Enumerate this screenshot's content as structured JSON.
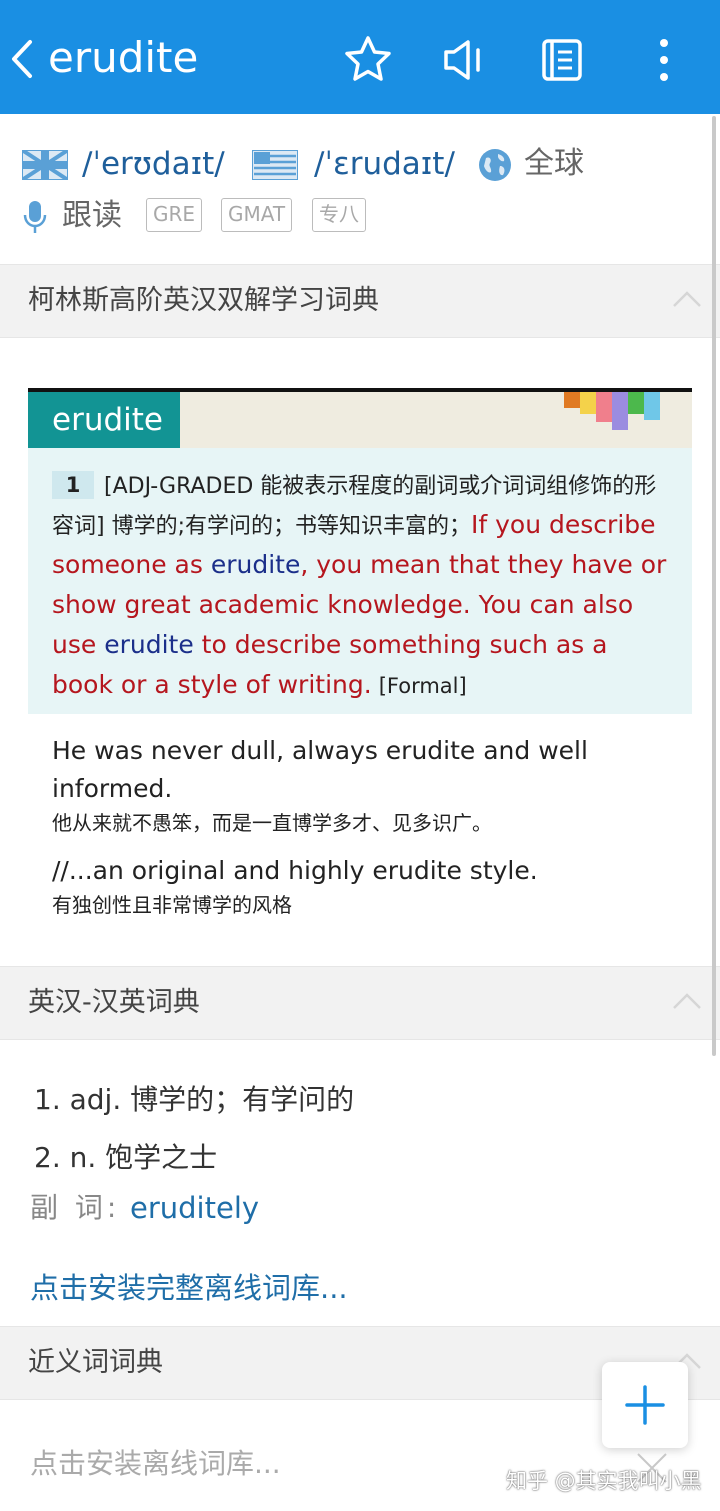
{
  "header": {
    "title": "erudite",
    "icons": [
      "back-icon",
      "star-icon",
      "speaker-icon",
      "notebook-icon",
      "more-icon"
    ]
  },
  "pronunciation": {
    "uk": "/ˈerʊdaɪt/",
    "us": "/ˈɛrudaɪt/",
    "global_label": "全球",
    "follow_read": "跟读",
    "tags": [
      "GRE",
      "GMAT",
      "专八"
    ]
  },
  "collins": {
    "section_title": "柯林斯高阶英汉双解学习词典",
    "headword": "erudite",
    "sense_number": "1",
    "grammar": "[ADJ-GRADED 能被表示程度的副词或介词词组修饰的形容词]",
    "cn_def": "博学的;有学问的；书等知识丰富的；",
    "en_def_1": "If you describe someone as ",
    "en_def_word_1": "erudite",
    "en_def_2": ", you mean that they have or show great academic knowledge. You can also use ",
    "en_def_word_2": "erudite",
    "en_def_3": " to describe something such as a book or a style of writing.",
    "register": "[Formal]",
    "examples": [
      {
        "en": "He was never dull, always erudite and well informed.",
        "cn": "他从来就不愚笨，而是一直博学多才、见多识广。"
      },
      {
        "en": "//...an original and highly erudite style.",
        "cn": "有独创性且非常博学的风格"
      }
    ]
  },
  "ec_dict": {
    "section_title": "英汉-汉英词典",
    "def1": "1. adj. 博学的；有学问的",
    "def2": "2. n. 饱学之士",
    "adverb_label": "副 词:",
    "adverb_word": "eruditely",
    "install_link": "点击安装完整离线词库..."
  },
  "synonyms": {
    "section_title": "近义词词典",
    "install_link": "点击安装离线词库..."
  },
  "watermark": "知乎 @其实我叫小黑",
  "colors": {
    "app_bar": "#1a8fe3",
    "collins_teal": "#129494",
    "definition_red": "#b5161e",
    "link_blue": "#1f6ea8"
  }
}
